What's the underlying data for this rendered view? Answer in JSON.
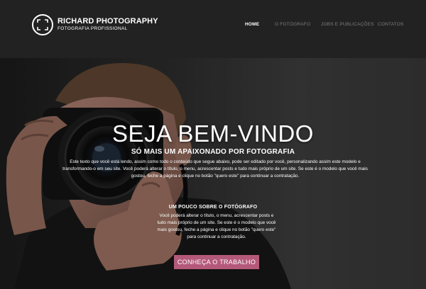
{
  "brand": {
    "title": "RICHARD PHOTOGRAPHY",
    "subtitle": "FOTOGRAFIA PROFISSIONAL"
  },
  "nav": {
    "items": [
      {
        "label": "HOME",
        "active": true
      },
      {
        "label": "O FOTÓGRAFO",
        "active": false
      },
      {
        "label": "JOBS E PUBLICAÇÕES",
        "active": false
      },
      {
        "label": "CONTATOS",
        "active": false
      }
    ]
  },
  "hero": {
    "title": "SEJA BEM-VINDO",
    "subtitle": "SÓ MAIS UM APAIXONADO POR FOTOGRAFIA",
    "text": "Este texto que você está lendo, assim como todo o conteúdo que segue abaixo, pode ser editado por você, personalizando assim este modelo e transformando-o em seu site. Você poderá alterar o título, o menu, acrescentar posts e tudo mais próprio de um site. Se este é o modelo que você mais gostou, feche a página e clique no botão \"quero este\" para continuar a contratação."
  },
  "about": {
    "title": "UM POUCO SOBRE O FOTÓGRAFO",
    "text": "Você poderá alterar o título, o menu, acrescentar posts e tudo mais próprio de um site. Se este é o modelo que você mais gostou, feche a página e clique no botão \"quero este\" para continuar a contratação."
  },
  "cta": {
    "label": "CONHEÇA O TRABALHO"
  },
  "colors": {
    "header_bg": "#232222",
    "nav_inactive": "#7d7d7d",
    "cta_bg": "#b4597a"
  }
}
